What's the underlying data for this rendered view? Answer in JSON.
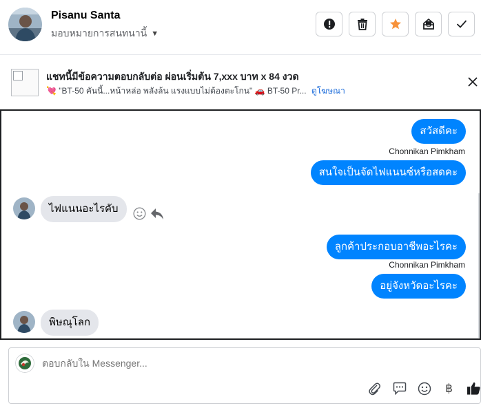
{
  "header": {
    "name": "Pisanu Santa",
    "assign_label": "มอบหมายการสนทนานี้",
    "actions": [
      {
        "icon": "alert-icon"
      },
      {
        "icon": "trash-icon"
      },
      {
        "icon": "star-icon",
        "color": "#f7923b"
      },
      {
        "icon": "archive-inbox-icon"
      },
      {
        "icon": "check-icon"
      }
    ]
  },
  "ad": {
    "title": "แชทนี้มีข้อความตอบกลับต่อ ผ่อนเริ่มต้น 7,xxx บาท x 84 งวด",
    "desc_text": "\"BT-50 คันนี้...หน้าหล่อ พลังล้น แรงแบบไม่ต้องตะโกน\"",
    "desc_text2": "BT-50 Pr...",
    "link": "ดูโฆษณา"
  },
  "messages": [
    {
      "dir": "out",
      "text": "สวัสดีคะ"
    },
    {
      "dir": "sender",
      "text": "Chonnikan Pimkham"
    },
    {
      "dir": "out",
      "text": "สนใจเป็นจัดไฟแนนซ์หรือสดคะ"
    },
    {
      "dir": "in",
      "text": "ไฟแนนอะไรคับ"
    },
    {
      "dir": "out",
      "text": "ลูกค้าประกอบอาชีพอะไรคะ"
    },
    {
      "dir": "sender",
      "text": "Chonnikan Pimkham"
    },
    {
      "dir": "out",
      "text": "อยู่จังหวัดอะไรคะ"
    },
    {
      "dir": "in",
      "text": "พิษณุโลก"
    }
  ],
  "composer": {
    "placeholder": "ตอบกลับใน Messenger...",
    "tools": [
      "paperclip-icon",
      "comment-icon",
      "emoji-icon",
      "baht-icon",
      "thumbs-up-icon"
    ],
    "baht_symbol": "฿"
  },
  "colors": {
    "accent": "#0084ff",
    "bubble_in": "#e4e6eb",
    "star": "#f7923b"
  }
}
